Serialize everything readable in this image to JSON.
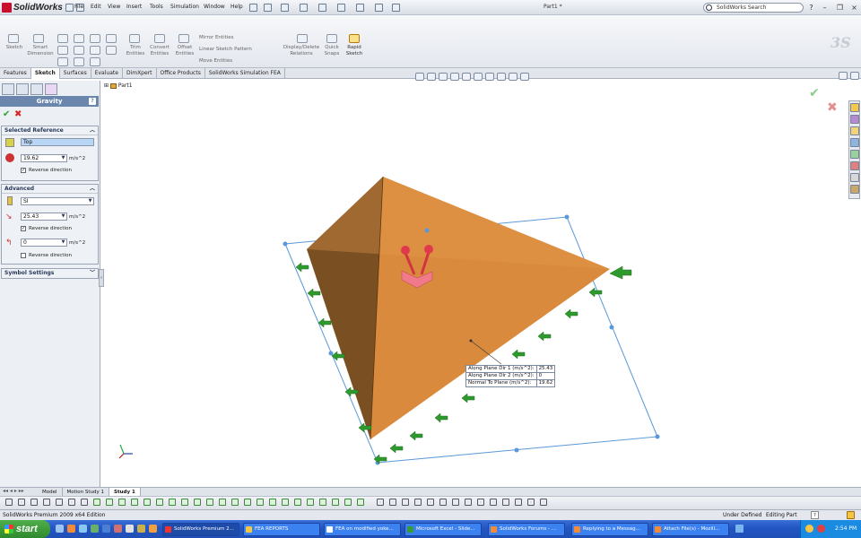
{
  "app": {
    "name": "SolidWorks",
    "doc_title": "Part1 *",
    "brand_colors": {
      "accent": "#c8102e",
      "ok": "#2fa02f",
      "cancel": "#dd2222",
      "part": "#d9873a"
    }
  },
  "menu": [
    "File",
    "Edit",
    "View",
    "Insert",
    "Tools",
    "Simulation",
    "Window",
    "Help"
  ],
  "search": {
    "placeholder": "SolidWorks Search"
  },
  "command_manager": {
    "sketch": "Sketch",
    "smart_dimension": "Smart Dimension",
    "trim_entities": "Trim Entities",
    "convert_entities": "Convert Entities",
    "offset_entities": "Offset Entities",
    "mirror_entities": "Mirror Entities",
    "linear_pattern": "Linear Sketch Pattern",
    "move_entities": "Move Entities",
    "display_relations": "Display/Delete Relations",
    "quick_snaps": "Quick Snaps",
    "rapid_sketch": "Rapid Sketch"
  },
  "tabs": [
    "Features",
    "Sketch",
    "Surfaces",
    "Evaluate",
    "DimXpert",
    "Office Products",
    "SolidWorks Simulation FEA"
  ],
  "active_tab": "Sketch",
  "property_manager": {
    "title": "Gravity",
    "help": "?",
    "selected_reference": {
      "header": "Selected Reference",
      "reference": "Top",
      "value": "19.62",
      "unit": "m/s^2",
      "reverse_label": "Reverse direction",
      "reverse_checked": true
    },
    "advanced": {
      "header": "Advanced",
      "units": "SI",
      "dir1_value": "25.43",
      "dir1_unit": "m/s^2",
      "dir1_reverse_label": "Reverse direction",
      "dir1_reverse_checked": true,
      "dir2_value": "0",
      "dir2_unit": "m/s^2",
      "dir2_reverse_label": "Reverse direction",
      "dir2_reverse_checked": false
    },
    "symbol_settings": {
      "header": "Symbol Settings"
    }
  },
  "tree": {
    "root": "Part1"
  },
  "readout": [
    {
      "label": "Along Plane Dir 1 (m/s^2):",
      "value": "25.43"
    },
    {
      "label": "Along Plane Dir 2 (m/s^2):",
      "value": "0"
    },
    {
      "label": "Normal To Plane (m/s^2):",
      "value": "19.62"
    }
  ],
  "bottom_tabs": [
    "Model",
    "Motion Study 1",
    "Study 1"
  ],
  "active_bottom_tab": "Study 1",
  "status": {
    "edition": "SolidWorks Premium 2009 x64 Edition",
    "state": "Under Defined",
    "mode": "Editing Part",
    "help": "?"
  },
  "taskbar": {
    "start": "start",
    "tasks": [
      "SolidWorks Premium 2...",
      "FEA REPORTS",
      "FEA on modified yoke...",
      "Microsoft Excel - Slide...",
      "SolidWorks Forums - ...",
      "Replying to a Messag...",
      "Attach File(s) - Mozill..."
    ],
    "clock": "2:54 PM"
  }
}
